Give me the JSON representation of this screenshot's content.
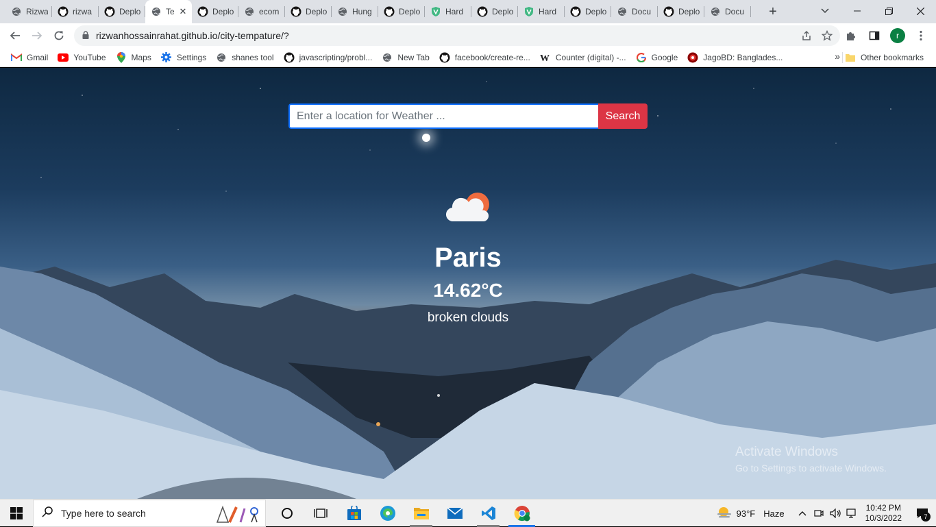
{
  "browser": {
    "tabs": [
      {
        "label": "Rizwa",
        "icon": "globe-icon"
      },
      {
        "label": "rizwa",
        "icon": "github-icon"
      },
      {
        "label": "Deplo",
        "icon": "github-icon"
      },
      {
        "label": "Te",
        "icon": "globe-icon",
        "active": true
      },
      {
        "label": "Deplo",
        "icon": "github-icon"
      },
      {
        "label": "ecom",
        "icon": "globe-icon"
      },
      {
        "label": "Deplo",
        "icon": "github-icon"
      },
      {
        "label": "Hung",
        "icon": "globe-icon"
      },
      {
        "label": "Deplo",
        "icon": "github-icon"
      },
      {
        "label": "Hard",
        "icon": "shield-icon"
      },
      {
        "label": "Deplo",
        "icon": "github-icon"
      },
      {
        "label": "Hard",
        "icon": "shield-icon"
      },
      {
        "label": "Deplo",
        "icon": "github-icon"
      },
      {
        "label": "Docu",
        "icon": "globe-icon"
      },
      {
        "label": "Deplo",
        "icon": "github-icon"
      },
      {
        "label": "Docu",
        "icon": "globe-icon"
      }
    ],
    "new_tab_label": "+",
    "url": "rizwanhossainrahat.github.io/city-tempature/?",
    "profile_initial": "r",
    "bookmarks": [
      {
        "label": "Gmail",
        "icon": "gmail-icon"
      },
      {
        "label": "YouTube",
        "icon": "youtube-icon"
      },
      {
        "label": "Maps",
        "icon": "maps-icon"
      },
      {
        "label": "Settings",
        "icon": "settings-gear-icon"
      },
      {
        "label": "shanes tool",
        "icon": "globe-icon"
      },
      {
        "label": "javascripting/probl...",
        "icon": "github-icon"
      },
      {
        "label": "New Tab",
        "icon": "globe-icon"
      },
      {
        "label": "facebook/create-re...",
        "icon": "github-icon"
      },
      {
        "label": "Counter (digital) -...",
        "icon": "wikipedia-icon"
      },
      {
        "label": "Google",
        "icon": "google-icon"
      },
      {
        "label": "JagoBD: Banglades...",
        "icon": "jagobd-icon"
      }
    ],
    "bookmarks_more": "»",
    "other_bookmarks": "Other bookmarks"
  },
  "page": {
    "search_placeholder": "Enter a location for Weather ...",
    "search_button": "Search",
    "city": "Paris",
    "temperature": "14.62°C",
    "description": "broken clouds",
    "weather_icon": "cloud-sun-icon"
  },
  "watermark": {
    "line1": "Activate Windows",
    "line2": "Go to Settings to activate Windows."
  },
  "taskbar": {
    "search_placeholder": "Type here to search",
    "weather_temp": "93°F",
    "weather_text": "Haze",
    "time": "10:42 PM",
    "date": "10/3/2022",
    "notification_count": "7"
  },
  "colors": {
    "search_button": "#dc3545",
    "input_border": "#0d6efd",
    "tab_strip": "#dee1e6",
    "taskbar": "#f0f0f0"
  }
}
